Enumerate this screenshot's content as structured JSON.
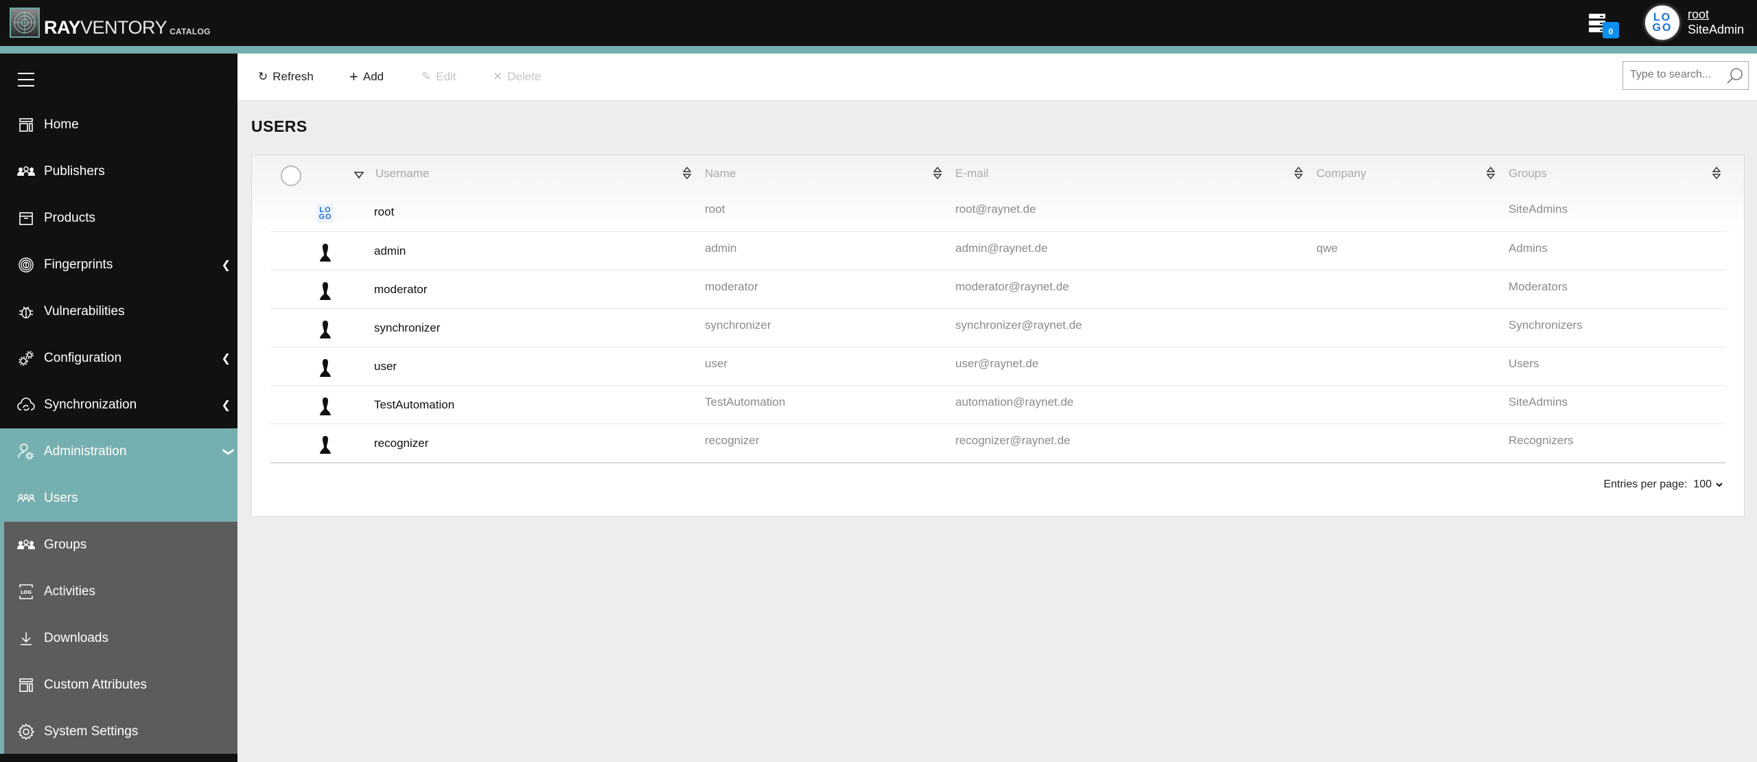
{
  "app": {
    "brand_bold": "RAY",
    "brand_light": "VENTORY",
    "brand_sub": "CATALOG"
  },
  "header": {
    "notification_count": "0",
    "avatar_text_top": "LO",
    "avatar_text_bottom": "GO",
    "user_name": "root",
    "user_role": "SiteAdmin"
  },
  "sidebar": {
    "items": [
      {
        "label": "Home",
        "icon": "layout-icon"
      },
      {
        "label": "Publishers",
        "icon": "people-icon"
      },
      {
        "label": "Products",
        "icon": "box-icon"
      },
      {
        "label": "Fingerprints",
        "icon": "fingerprint-icon",
        "expandable": true
      },
      {
        "label": "Vulnerabilities",
        "icon": "bug-icon"
      },
      {
        "label": "Configuration",
        "icon": "gears-icon",
        "expandable": true
      },
      {
        "label": "Synchronization",
        "icon": "cloud-sync-icon",
        "expandable": true
      },
      {
        "label": "Administration",
        "icon": "user-gear-icon",
        "expanded": true
      },
      {
        "label": "Users",
        "icon": "users-icon",
        "active": true
      },
      {
        "label": "Groups",
        "icon": "people-icon"
      },
      {
        "label": "Activities",
        "icon": "log-icon"
      },
      {
        "label": "Downloads",
        "icon": "download-icon"
      },
      {
        "label": "Custom Attributes",
        "icon": "layout-icon"
      },
      {
        "label": "System Settings",
        "icon": "gear-icon"
      }
    ]
  },
  "toolbar": {
    "refresh_label": "Refresh",
    "add_label": "Add",
    "edit_label": "Edit",
    "delete_label": "Delete",
    "search_placeholder": "Type to search..."
  },
  "page": {
    "title": "USERS"
  },
  "table": {
    "columns": [
      "Username",
      "Name",
      "E-mail",
      "Company",
      "Groups"
    ],
    "rows": [
      {
        "avatar": "logo",
        "username": "root",
        "name": "root",
        "email": "root@raynet.de",
        "company": "",
        "groups": "SiteAdmins"
      },
      {
        "avatar": "silhouette",
        "username": "admin",
        "name": "admin",
        "email": "admin@raynet.de",
        "company": "qwe",
        "groups": "Admins"
      },
      {
        "avatar": "silhouette",
        "username": "moderator",
        "name": "moderator",
        "email": "moderator@raynet.de",
        "company": "",
        "groups": "Moderators"
      },
      {
        "avatar": "silhouette",
        "username": "synchronizer",
        "name": "synchronizer",
        "email": "synchronizer@raynet.de",
        "company": "",
        "groups": "Synchronizers"
      },
      {
        "avatar": "silhouette",
        "username": "user",
        "name": "user",
        "email": "user@raynet.de",
        "company": "",
        "groups": "Users"
      },
      {
        "avatar": "silhouette",
        "username": "TestAutomation",
        "name": "TestAutomation",
        "email": "automation@raynet.de",
        "company": "",
        "groups": "SiteAdmins"
      },
      {
        "avatar": "silhouette",
        "username": "recognizer",
        "name": "recognizer",
        "email": "recognizer@raynet.de",
        "company": "",
        "groups": "Recognizers"
      }
    ],
    "entries_per_page_label": "Entries per page:",
    "entries_per_page_value": "100"
  },
  "colors": {
    "accent_teal": "#76afaf",
    "topbar": "#111111",
    "submenu": "#5c5c5c",
    "badge_blue": "#0b8ff0"
  }
}
